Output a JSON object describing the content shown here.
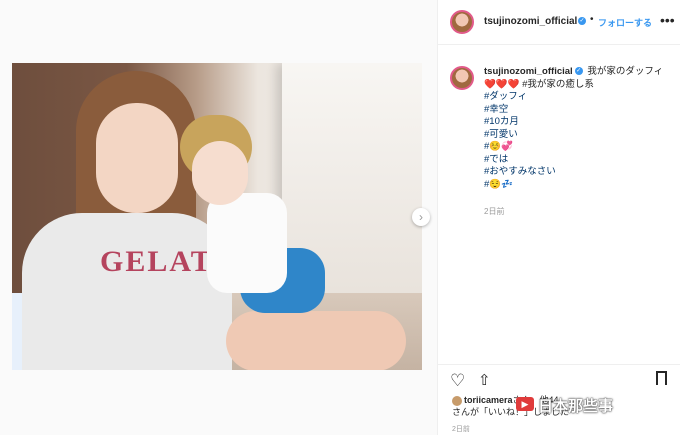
{
  "post": {
    "username": "tsujinozomi_official",
    "verified_mark": "✓",
    "separator": "•",
    "follow_label": "フォローする",
    "more_label": "•••"
  },
  "caption": {
    "username": "tsujinozomi_official",
    "line1": "我が家のダッフィ❤️❤️❤️ #我が家の癒し系",
    "tags": [
      "#ダッフィ",
      "#幸空",
      "#10カ月",
      "#可愛い",
      "#☺️💞",
      "#では",
      "#おやすみなさい",
      "#😌💤"
    ],
    "time_ago": "2日前"
  },
  "photo": {
    "shirt_text": "GELATO",
    "next_arrow": "›"
  },
  "actions": {
    "heart_icon": "♡",
    "share_icon": "⇧"
  },
  "likes": {
    "text_a": "toriicamera",
    "text_b": "さん、他44",
    "text_c": "さんが「いいね！」しました"
  },
  "date": "2日前",
  "watermark": {
    "text": "日本那些事",
    "icon": "▶"
  }
}
